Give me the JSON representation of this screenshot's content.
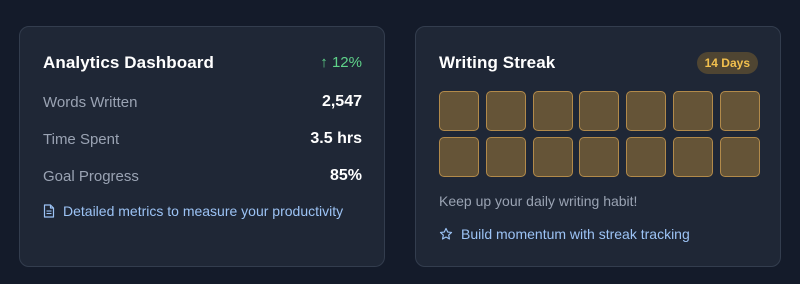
{
  "analytics": {
    "title": "Analytics Dashboard",
    "trend": "↑ 12%",
    "trend_color": "#5fd38a",
    "metrics": [
      {
        "label": "Words Written",
        "value": "2,547"
      },
      {
        "label": "Time Spent",
        "value": "3.5 hrs"
      },
      {
        "label": "Goal Progress",
        "value": "85%"
      }
    ],
    "footer_icon": "document-icon",
    "footer_text": "Detailed metrics to measure your productivity"
  },
  "streak": {
    "title": "Writing Streak",
    "badge": "14 Days",
    "day_count": 14,
    "day_fill_color": "#655437",
    "day_border_color": "#b28a4a",
    "note": "Keep up your daily writing habit!",
    "footer_icon": "star-icon",
    "footer_text": "Build momentum with streak tracking"
  }
}
